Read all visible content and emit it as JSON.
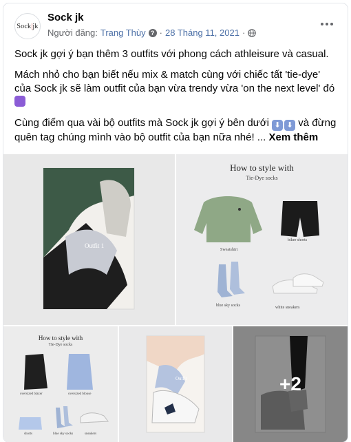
{
  "header": {
    "page_name": "Sock jk",
    "avatar_text_left": "Sock",
    "avatar_text_slash": "|",
    "avatar_text_right": "jk",
    "posted_by_label": "Người đăng:",
    "poster_name": "Trang Thùy",
    "date": "28 Tháng 11, 2021",
    "separator": "·"
  },
  "body": {
    "p1": "Sock jk gợi ý bạn thêm 3 outfits với phong cách athleisure và casual.",
    "p2": "Mách nhỏ cho bạn biết nếu mix & match cùng với chiếc tất 'tie-dye' của Sock jk sẽ làm outfit của bạn vừa trendy vừa 'on the next level' đó",
    "p3": "Cùng điểm qua vài bộ outfits mà Sock jk gợi ý bên dưới",
    "p3_cont": "và đừng quên tag chúng mình vào bộ outfit của bạn nữa nhé! ...",
    "see_more": "Xem thêm"
  },
  "gallery": {
    "tile1": {
      "label": "Outfit 1"
    },
    "tile2": {
      "title": "How to style with",
      "subtitle": "Tie-Dye socks",
      "items": [
        "Sweatshirt",
        "biker shorts",
        "blue sky socks",
        "white sneakers"
      ]
    },
    "tile3": {
      "title": "How to style with",
      "subtitle": "Tie-Dye socks",
      "items": [
        "oversized blazer",
        "oversized blouse",
        "shorts",
        "blue sky socks",
        "sneakers"
      ]
    },
    "tile4": {
      "label": "Outfit"
    },
    "tile5": {
      "overlay": "+2"
    }
  },
  "colors": {
    "link_blue": "#4b6fa6",
    "meta_gray": "#65676b",
    "sweatshirt_green": "#8fa886",
    "sky_sock_blue": "#9fb3d4"
  }
}
